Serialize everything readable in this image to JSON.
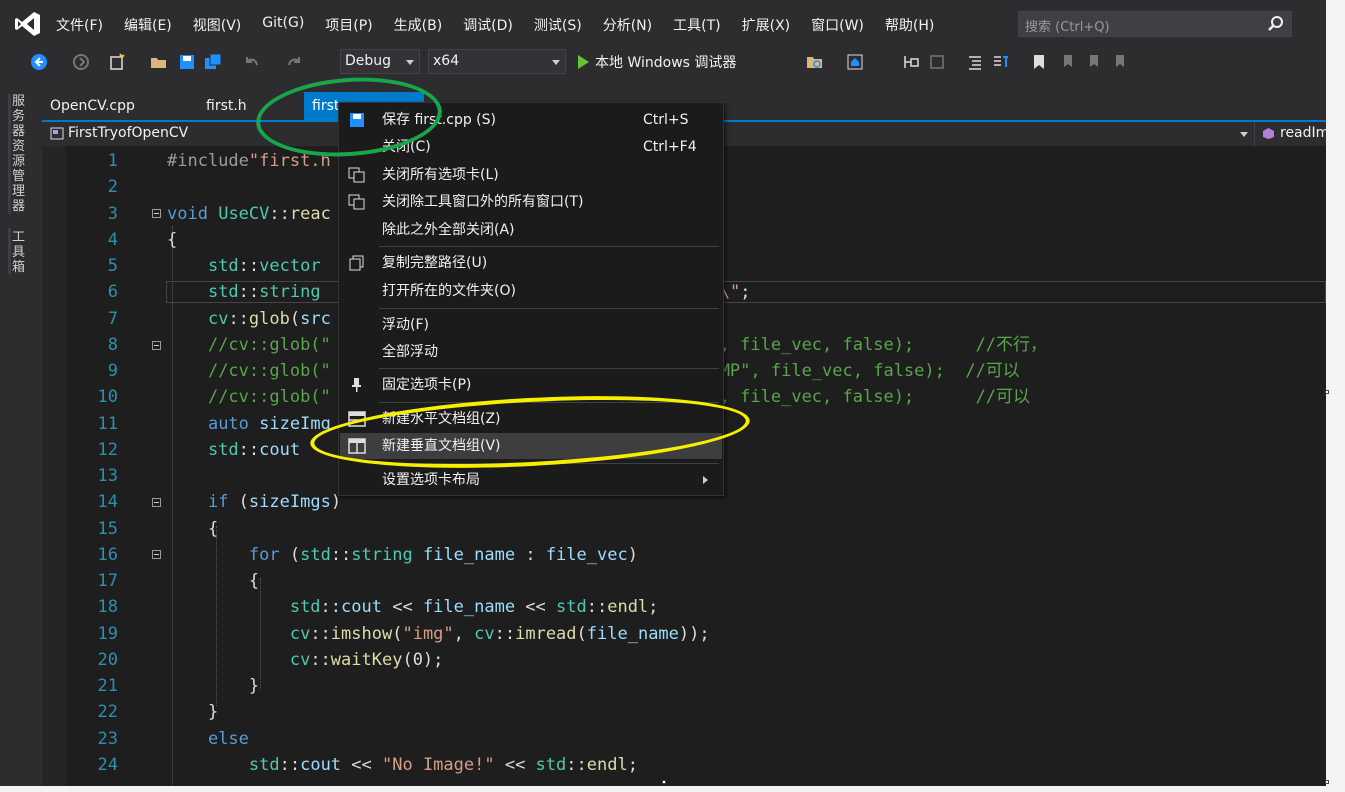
{
  "menubar": {
    "items": [
      "文件(F)",
      "编辑(E)",
      "视图(V)",
      "Git(G)",
      "项目(P)",
      "生成(B)",
      "调试(D)",
      "测试(S)",
      "分析(N)",
      "工具(T)",
      "扩展(X)",
      "窗口(W)",
      "帮助(H)"
    ],
    "search_placeholder": "搜索 (Ctrl+Q)"
  },
  "toolbar": {
    "config": "Debug",
    "platform": "x64",
    "run_label": "本地 Windows 调试器"
  },
  "leftdock": {
    "server_explorer": "服务器资源管理器",
    "toolbox": "工具箱"
  },
  "tabs": [
    "OpenCV.cpp",
    "first.h",
    "first"
  ],
  "navbar": {
    "project": "FirstTryofOpenCV",
    "member": "readIm"
  },
  "editor": {
    "line_numbers": [
      "1",
      "2",
      "3",
      "4",
      "5",
      "6",
      "7",
      "8",
      "9",
      "10",
      "11",
      "12",
      "13",
      "14",
      "15",
      "16",
      "17",
      "18",
      "19",
      "20",
      "21",
      "22",
      "23",
      "24"
    ]
  },
  "context_menu": {
    "items": [
      {
        "label": "保存 first.cpp (S)",
        "shortcut": "Ctrl+S",
        "icon": "save-icon"
      },
      {
        "label": "关闭(C)",
        "shortcut": "Ctrl+F4",
        "icon": ""
      },
      {
        "label": "关闭所有选项卡(L)",
        "shortcut": "",
        "icon": "close-all-tabs-icon"
      },
      {
        "label": "关闭除工具窗口外的所有窗口(T)",
        "shortcut": "",
        "icon": "close-windows-icon"
      },
      {
        "label": "除此之外全部关闭(A)",
        "shortcut": "",
        "icon": ""
      },
      {
        "label": "复制完整路径(U)",
        "shortcut": "",
        "icon": "copy-path-icon"
      },
      {
        "label": "打开所在的文件夹(O)",
        "shortcut": "",
        "icon": ""
      },
      {
        "label": "浮动(F)",
        "shortcut": "",
        "icon": ""
      },
      {
        "label": "全部浮动",
        "shortcut": "",
        "icon": ""
      },
      {
        "label": "固定选项卡(P)",
        "shortcut": "",
        "icon": "pin-icon"
      },
      {
        "label": "新建水平文档组(Z)",
        "shortcut": "",
        "icon": "horizontal-group-icon"
      },
      {
        "label": "新建垂直文档组(V)",
        "shortcut": "",
        "icon": "vertical-group-icon"
      },
      {
        "label": "设置选项卡布局",
        "shortcut": "",
        "icon": ""
      }
    ]
  },
  "colors": {
    "accent": "#007acc",
    "annotation_green": "#19a64b",
    "annotation_yellow": "#f6f000"
  }
}
